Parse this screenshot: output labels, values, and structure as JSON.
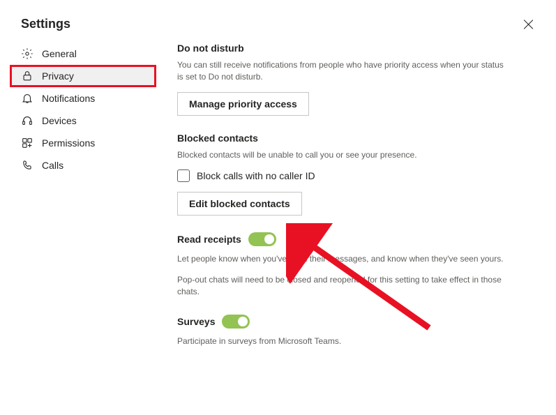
{
  "header": {
    "title": "Settings"
  },
  "sidebar": {
    "items": [
      {
        "label": "General"
      },
      {
        "label": "Privacy"
      },
      {
        "label": "Notifications"
      },
      {
        "label": "Devices"
      },
      {
        "label": "Permissions"
      },
      {
        "label": "Calls"
      }
    ]
  },
  "content": {
    "dnd": {
      "title": "Do not disturb",
      "desc": "You can still receive notifications from people who have priority access when your status is set to Do not disturb.",
      "button": "Manage priority access"
    },
    "blocked": {
      "title": "Blocked contacts",
      "desc": "Blocked contacts will be unable to call you or see your presence.",
      "checkbox_label": "Block calls with no caller ID",
      "button": "Edit blocked contacts"
    },
    "read_receipts": {
      "title": "Read receipts",
      "desc1": "Let people know when you've seen their messages, and know when they've seen yours.",
      "desc2": "Pop-out chats will need to be closed and reopened for this setting to take effect in those chats."
    },
    "surveys": {
      "title": "Surveys",
      "desc": "Participate in surveys from Microsoft Teams."
    }
  }
}
